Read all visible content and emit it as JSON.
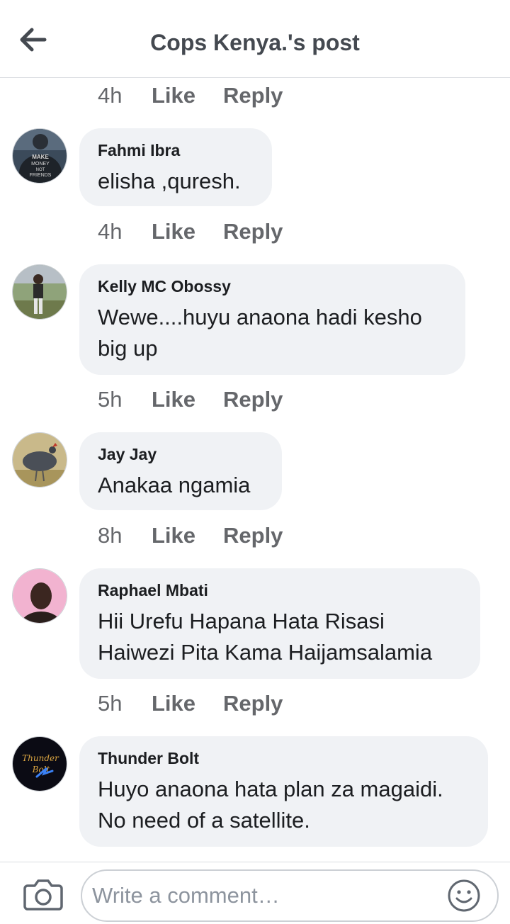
{
  "header": {
    "title": "Cops Kenya.'s post"
  },
  "action_labels": {
    "like": "Like",
    "reply": "Reply"
  },
  "top_actions": {
    "time": "4h"
  },
  "comments": [
    {
      "author": "Fahmi Ibra",
      "text": "elisha ,quresh.",
      "time": "4h",
      "avatar_text": "MAKE MONEY NOT FRIENDS"
    },
    {
      "author": "Kelly MC Obossy",
      "text": "Wewe....huyu anaona hadi kesho big up",
      "time": "5h"
    },
    {
      "author": "Jay Jay",
      "text": "Anakaa ngamia",
      "time": "8h"
    },
    {
      "author": "Raphael Mbati",
      "text": "Hii Urefu Hapana Hata Risasi Haiwezi Pita Kama Haijamsalamia",
      "time": "5h"
    },
    {
      "author": "Thunder Bolt",
      "text": "Huyo anaona hata plan za magaidi. No need of a satellite.",
      "avatar_text": "Thunder Bolt"
    }
  ],
  "composer": {
    "placeholder": "Write a comment…"
  },
  "icons": {
    "back": "arrow-left-icon",
    "camera": "camera-icon",
    "emoji": "smiley-icon"
  },
  "colors": {
    "bubble": "#f0f2f5",
    "meta_text": "#65676b",
    "header_text": "#444950"
  }
}
